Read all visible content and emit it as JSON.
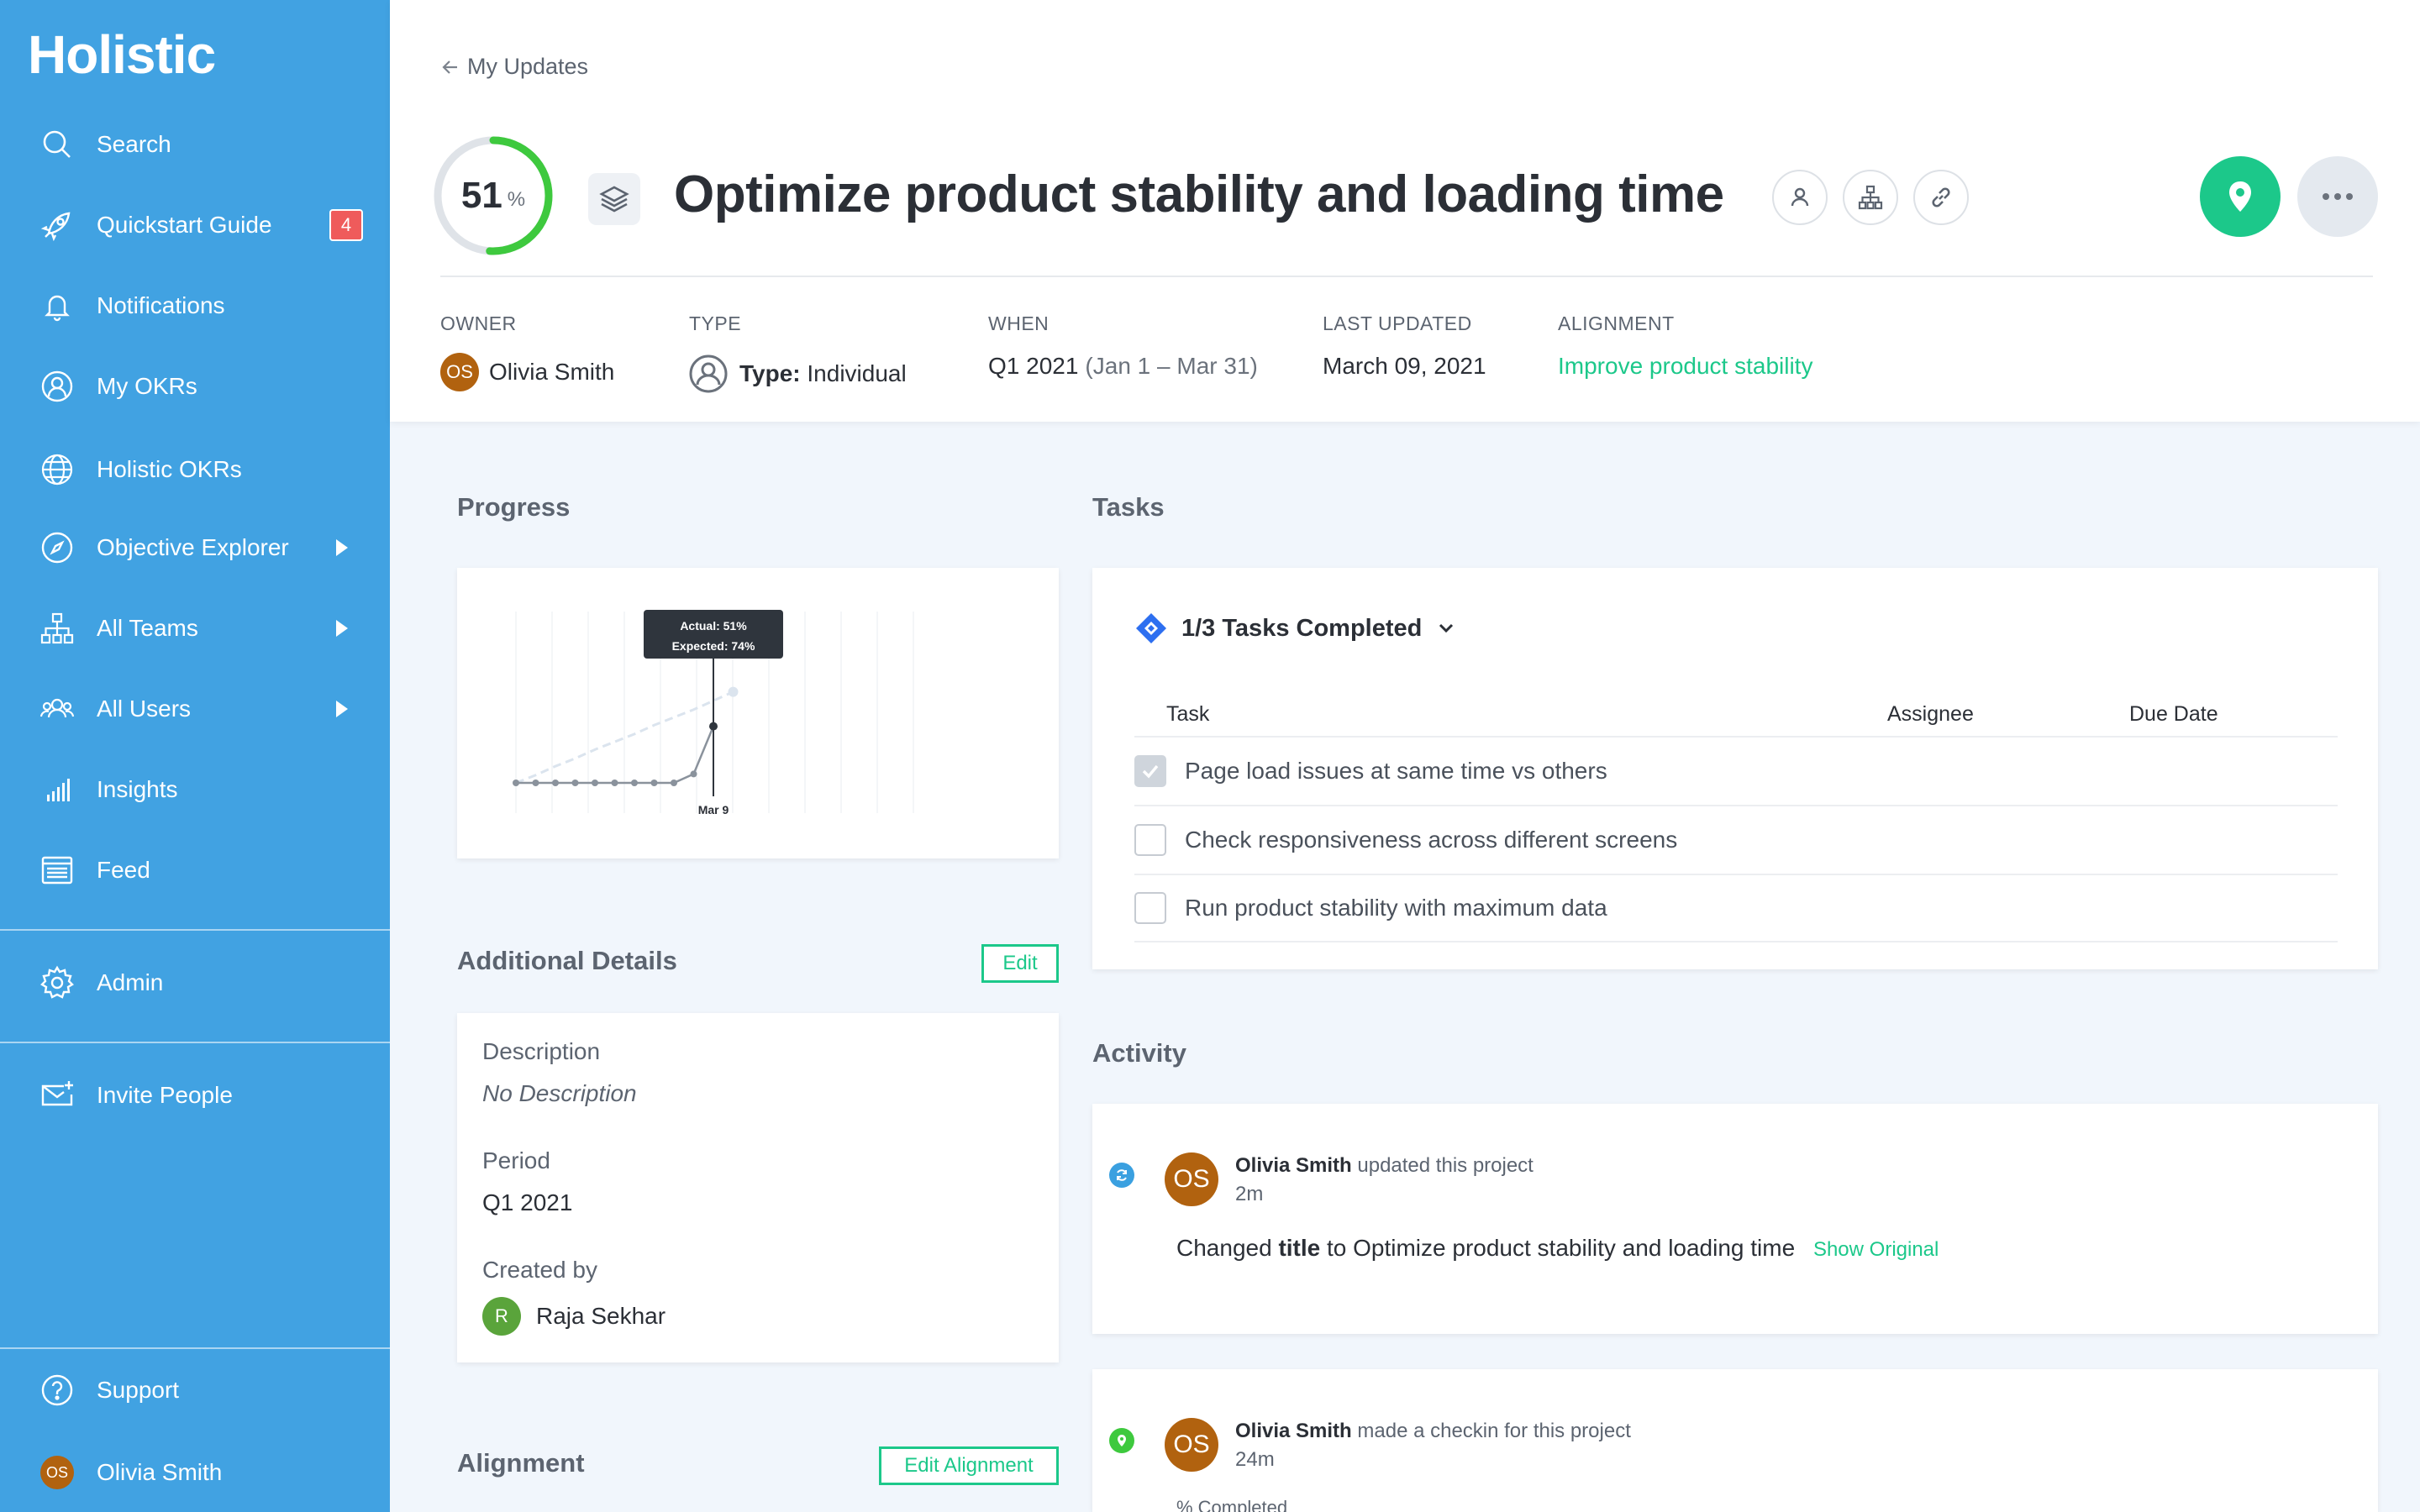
{
  "app": {
    "logo": "Holistic"
  },
  "sidebar": {
    "items": [
      {
        "label": "Search",
        "icon": "search-icon"
      },
      {
        "label": "Quickstart Guide",
        "icon": "rocket-icon",
        "badge": "4"
      },
      {
        "label": "Notifications",
        "icon": "bell-icon"
      },
      {
        "label": "My OKRs",
        "icon": "user-circle-icon"
      },
      {
        "label": "Holistic OKRs",
        "icon": "globe-icon"
      },
      {
        "label": "Objective Explorer",
        "icon": "compass-icon"
      },
      {
        "label": "All Teams",
        "icon": "org-chart-icon"
      },
      {
        "label": "All Users",
        "icon": "users-icon"
      },
      {
        "label": "Insights",
        "icon": "bar-chart-icon"
      },
      {
        "label": "Feed",
        "icon": "feed-icon"
      }
    ],
    "admin": "Admin",
    "invite": "Invite People",
    "support": "Support",
    "user": {
      "name": "Olivia Smith",
      "initials": "OS"
    }
  },
  "header": {
    "breadcrumb": "My Updates",
    "progress": {
      "value": "51",
      "unit": "%",
      "fraction": 0.51
    },
    "title": "Optimize product stability and loading time",
    "meta": {
      "owner_label": "OWNER",
      "owner_initials": "OS",
      "owner_name": "Olivia Smith",
      "type_label": "TYPE",
      "type_key": "Type:",
      "type_value": "Individual",
      "when_label": "WHEN",
      "when_quarter": "Q1 2021",
      "when_range": "(Jan 1 – Mar 31)",
      "updated_label": "LAST UPDATED",
      "updated_value": "March 09, 2021",
      "alignment_label": "ALIGNMENT",
      "alignment_value": "Improve product stability"
    }
  },
  "progress_section": {
    "title": "Progress",
    "tooltip_actual": "Actual: 51%",
    "tooltip_expected": "Expected: 74%",
    "x_label": "Mar 9"
  },
  "chart_data": {
    "type": "line",
    "series": [
      {
        "values": [
          0,
          0,
          0,
          0,
          0,
          0,
          0,
          0,
          0,
          8,
          51
        ]
      },
      {
        "values": [
          0,
          7,
          15,
          22,
          30,
          37,
          44,
          52,
          59,
          66,
          74,
          82
        ]
      }
    ],
    "annotations": [
      "Actual: 51%",
      "Expected: 74%"
    ],
    "tick_labels": [
      "Mar 9"
    ],
    "ylim": [
      0,
      100
    ]
  },
  "details": {
    "title": "Additional Details",
    "edit": "Edit",
    "description_label": "Description",
    "description_value": "No Description",
    "period_label": "Period",
    "period_value": "Q1 2021",
    "created_label": "Created by",
    "created_initial": "R",
    "created_name": "Raja Sekhar"
  },
  "alignment": {
    "title": "Alignment",
    "edit": "Edit Alignment"
  },
  "tasks": {
    "title": "Tasks",
    "summary": "1/3 Tasks Completed",
    "columns": [
      "Task",
      "Assignee",
      "Due Date"
    ],
    "rows": [
      {
        "text": "Page load issues at same time vs others",
        "checked": true
      },
      {
        "text": "Check responsiveness across different screens",
        "checked": false
      },
      {
        "text": "Run product stability with maximum data",
        "checked": false
      }
    ]
  },
  "activity": {
    "title": "Activity",
    "items": [
      {
        "initials": "OS",
        "user": "Olivia Smith",
        "action": "updated this project",
        "time": "2m",
        "change_prefix": "Changed",
        "change_field": "title",
        "change_suffix": "to Optimize product stability and loading time",
        "show_original": "Show Original"
      },
      {
        "initials": "OS",
        "user": "Olivia Smith",
        "action": "made a checkin for this project",
        "time": "24m",
        "partial": "% Completed"
      }
    ]
  },
  "colors": {
    "sidebar": "#41a2e2",
    "accent": "#1cc88a",
    "badge": "#ef5b5b"
  }
}
